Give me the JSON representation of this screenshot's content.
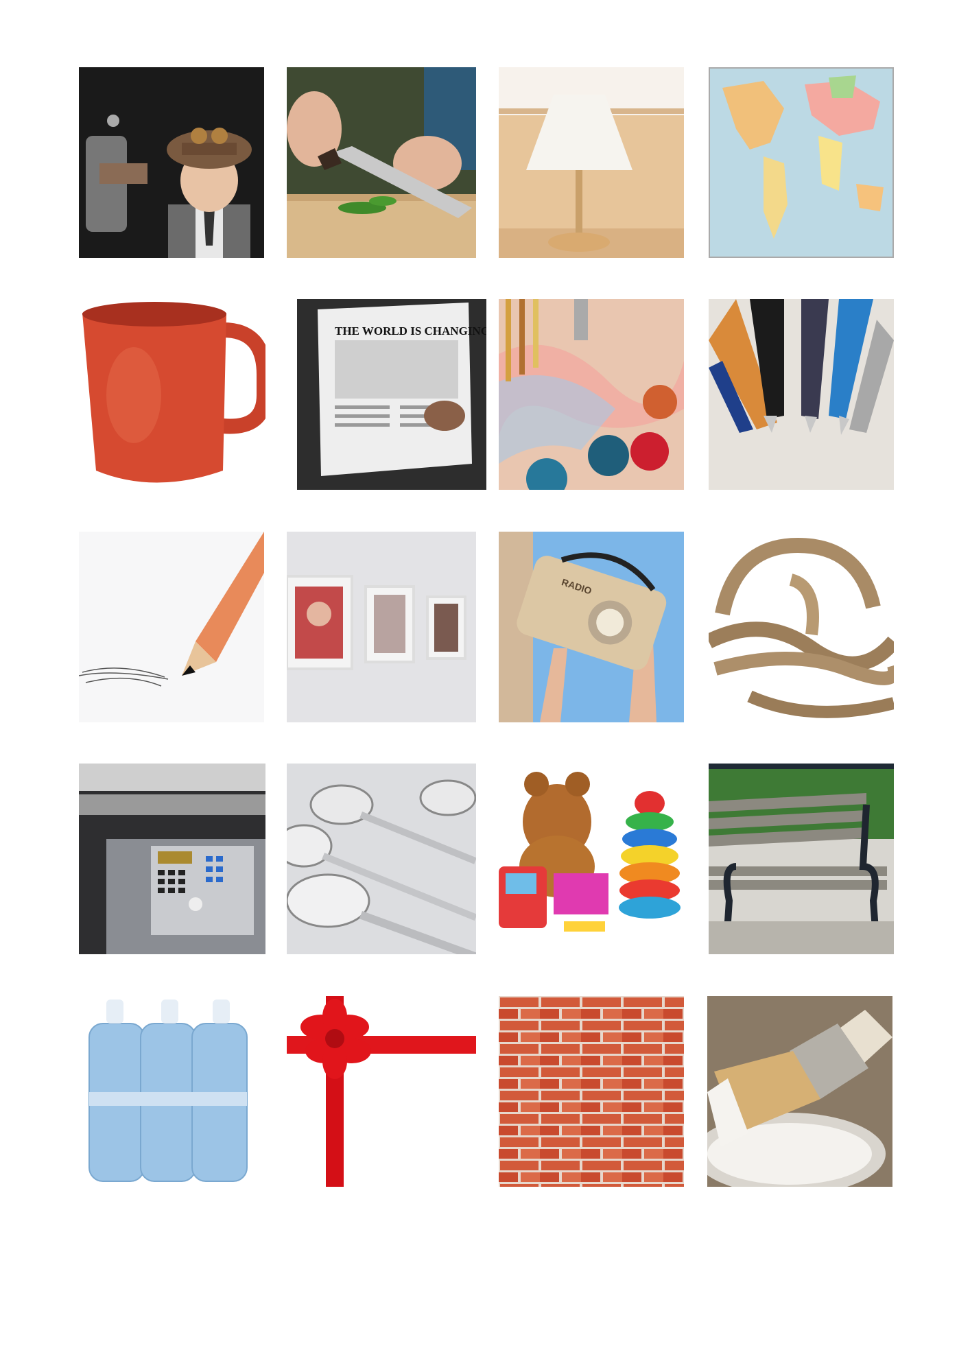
{
  "sheet": {
    "background": "#ffffff",
    "columns": 4,
    "rows": 5
  },
  "pictures": [
    {
      "id": "boy-with-toy-gun-icon",
      "subject": "boy in cap holding toy gun"
    },
    {
      "id": "kitchen-knife-icon",
      "subject": "knife chopping herbs"
    },
    {
      "id": "table-lamp-icon",
      "subject": "table lamp"
    },
    {
      "id": "world-map-icon",
      "subject": "world map"
    },
    {
      "id": "red-mug-icon",
      "subject": "red mug"
    },
    {
      "id": "newspaper-icon",
      "subject": "newspaper",
      "headline": "THE WORLD IS CHANGING"
    },
    {
      "id": "paint-palette-icon",
      "subject": "brushes and paint pots"
    },
    {
      "id": "ballpoint-pens-icon",
      "subject": "ballpoint pens"
    },
    {
      "id": "pencil-icon",
      "subject": "pencil drawing"
    },
    {
      "id": "picture-frames-icon",
      "subject": "framed pictures on wall"
    },
    {
      "id": "radio-icon",
      "subject": "retro radio",
      "label": "RADIO"
    },
    {
      "id": "rope-icon",
      "subject": "coiled rope"
    },
    {
      "id": "safe-icon",
      "subject": "electronic safe"
    },
    {
      "id": "spoons-icon",
      "subject": "spoons"
    },
    {
      "id": "toys-icon",
      "subject": "teddy bear and toys"
    },
    {
      "id": "park-bench-icon",
      "subject": "park bench"
    },
    {
      "id": "water-bottles-icon",
      "subject": "bottled water pack"
    },
    {
      "id": "gift-ribbon-icon",
      "subject": "red ribbon bow"
    },
    {
      "id": "brick-wall-icon",
      "subject": "brick wall"
    },
    {
      "id": "paintbrush-icon",
      "subject": "paintbrush on paint can"
    }
  ]
}
